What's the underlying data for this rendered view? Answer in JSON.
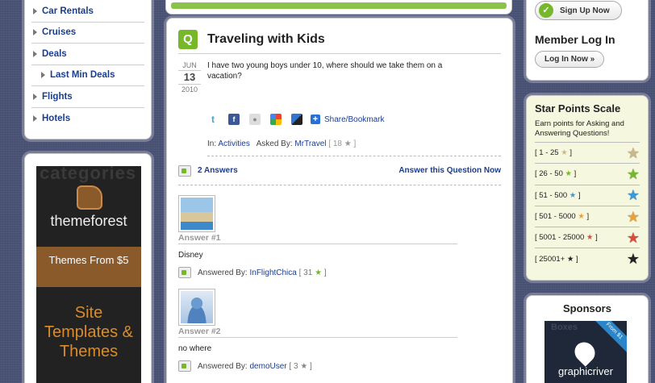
{
  "nav": {
    "items": [
      {
        "label": "Car Rentals",
        "sub": false
      },
      {
        "label": "Cruises",
        "sub": false
      },
      {
        "label": "Deals",
        "sub": false
      },
      {
        "label": "Last Min Deals",
        "sub": true
      },
      {
        "label": "Flights",
        "sub": false
      },
      {
        "label": "Hotels",
        "sub": false
      }
    ]
  },
  "ad": {
    "bg_text": "categories",
    "brand": "themeforest",
    "band": "Themes From $5",
    "site_text": "Site Templates & Themes"
  },
  "question": {
    "badge": "Q",
    "title": "Traveling with Kids",
    "month": "JUN",
    "day": "13",
    "year": "2010",
    "text": "I have two young boys under 10, where should we take them on a vacation?",
    "share_label": "Share/Bookmark",
    "in_label": "In:",
    "category": "Activities",
    "asked_by_label": "Asked By:",
    "asker": "MrTravel",
    "asker_points": "[ 18 ★ ]"
  },
  "answers_bar": {
    "count_label": "2 Answers",
    "answer_now": "Answer this Question Now"
  },
  "answers": [
    {
      "num": "Answer #1",
      "text": "Disney",
      "by_label": "Answered By:",
      "user": "InFlightChica",
      "points": "[ 31 ★ ]",
      "star_color": "#77b82a"
    },
    {
      "num": "Answer #2",
      "text": "no where",
      "by_label": "Answered By:",
      "user": "demoUser",
      "points": "[ 3 ★ ]",
      "star_color": "#888888"
    }
  ],
  "signup": {
    "label": "Sign Up Now"
  },
  "member": {
    "title": "Member Log In",
    "login_label": "Log In Now »"
  },
  "scale": {
    "title": "Star Points Scale",
    "desc": "Earn points for Asking and Answering Questions!",
    "levels": [
      {
        "range": "[ 1 - 25 ★ ]",
        "color": "#c9b98a"
      },
      {
        "range": "[ 26 - 50 ★ ]",
        "color": "#77b82a"
      },
      {
        "range": "[ 51 - 500 ★ ]",
        "color": "#3a9ad9"
      },
      {
        "range": "[ 501 - 5000 ★ ]",
        "color": "#f0a030"
      },
      {
        "range": "[ 5001 - 25000 ★ ]",
        "color": "#e04a3a"
      },
      {
        "range": "[ 25001+ ★ ]",
        "color": "#222222"
      }
    ]
  },
  "sponsors": {
    "title": "Sponsors",
    "brand": "graphicriver",
    "ribbon": "From $1",
    "bg_text": "Boxes"
  }
}
